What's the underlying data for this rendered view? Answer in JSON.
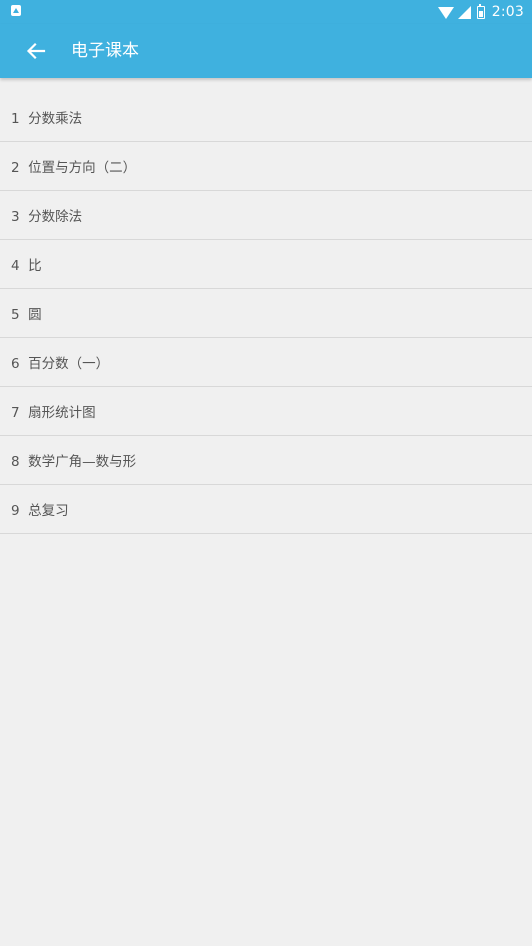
{
  "status_bar": {
    "time": "2:03",
    "icons": [
      "notification-icon",
      "wifi-icon",
      "signal-icon",
      "battery-icon"
    ]
  },
  "app_bar": {
    "back_icon": "arrow-left-icon",
    "title": "电子课本",
    "background": "#3fb1df"
  },
  "list": {
    "items": [
      {
        "label": "1  分数乘法"
      },
      {
        "label": "2  位置与方向（二）"
      },
      {
        "label": "3  分数除法"
      },
      {
        "label": "4  比"
      },
      {
        "label": "5  圆"
      },
      {
        "label": "6  百分数（一）"
      },
      {
        "label": "7  扇形统计图"
      },
      {
        "label": "8  数学广角—数与形"
      },
      {
        "label": "9  总复习"
      }
    ]
  }
}
